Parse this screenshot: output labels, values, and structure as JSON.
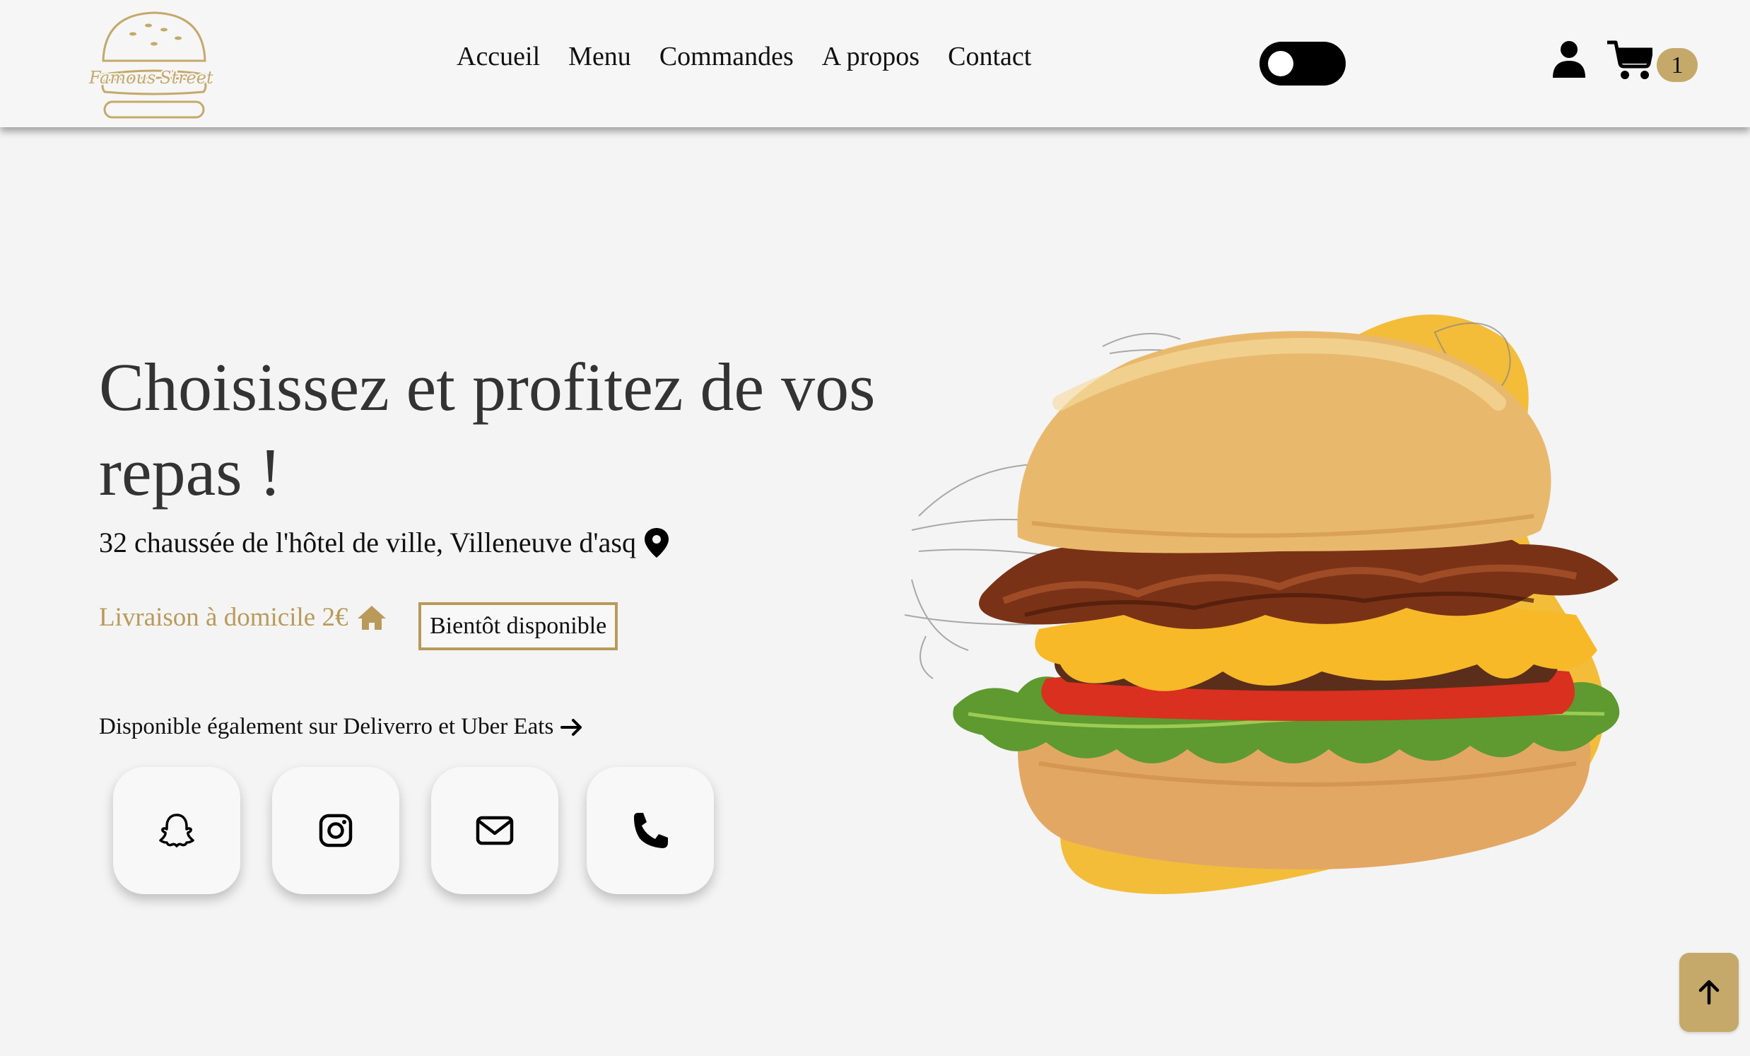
{
  "brand": {
    "logo_text_1": "Famous",
    "logo_text_2": "Street"
  },
  "nav": {
    "items": [
      "Accueil",
      "Menu",
      "Commandes",
      "A propos",
      "Contact"
    ]
  },
  "header": {
    "cart_count": "1",
    "theme_toggle": "off"
  },
  "hero": {
    "title": "Choisissez et profitez de vos repas !",
    "address": "32 chaussée de l'hôtel de ville, Villeneuve d'asq",
    "delivery_text": "Livraison à domicile 2€",
    "delivery_badge": "Bientôt disponible",
    "also_available": "Disponible également sur Deliverro et Uber Eats",
    "social": [
      "snapchat-icon",
      "instagram-icon",
      "mail-icon",
      "phone-icon"
    ]
  },
  "colors": {
    "accent": "#c4a96b",
    "accent_text": "#b99a5a",
    "blob": "#f3bd3a",
    "background": "#f4f4f4"
  }
}
